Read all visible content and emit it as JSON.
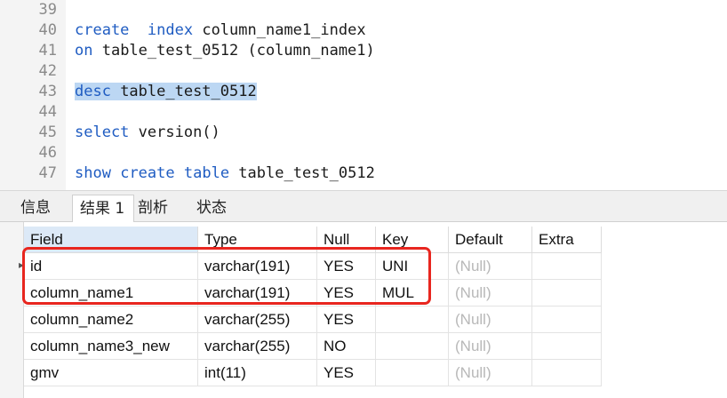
{
  "editor": {
    "lines": [
      {
        "num": "39",
        "parts": []
      },
      {
        "num": "40",
        "parts": [
          {
            "t": "create",
            "kw": true
          },
          {
            "t": "  ",
            "kw": false
          },
          {
            "t": "index",
            "kw": true
          },
          {
            "t": " column_name1_index",
            "kw": false
          }
        ]
      },
      {
        "num": "41",
        "parts": [
          {
            "t": "on",
            "kw": true
          },
          {
            "t": " table_test_0512 (column_name1)",
            "kw": false
          }
        ]
      },
      {
        "num": "42",
        "parts": []
      },
      {
        "num": "43",
        "parts": [
          {
            "t": "desc",
            "kw": true,
            "sel": true
          },
          {
            "t": " table_test_0512",
            "kw": false,
            "sel": true
          }
        ]
      },
      {
        "num": "44",
        "parts": []
      },
      {
        "num": "45",
        "parts": [
          {
            "t": "select",
            "kw": true
          },
          {
            "t": " version()",
            "kw": false
          }
        ]
      },
      {
        "num": "46",
        "parts": []
      },
      {
        "num": "47",
        "parts": [
          {
            "t": "show",
            "kw": true
          },
          {
            "t": " ",
            "kw": false
          },
          {
            "t": "create",
            "kw": true
          },
          {
            "t": " ",
            "kw": false
          },
          {
            "t": "table",
            "kw": true
          },
          {
            "t": " table_test_0512",
            "kw": false
          }
        ]
      }
    ]
  },
  "tabs": [
    {
      "label": "信息",
      "active": false
    },
    {
      "label": "结果 1",
      "active": true
    },
    {
      "label": "剖析",
      "active": false
    },
    {
      "label": "状态",
      "active": false
    }
  ],
  "grid": {
    "columns": [
      "Field",
      "Type",
      "Null",
      "Key",
      "Default",
      "Extra"
    ],
    "rows": [
      [
        "id",
        "varchar(191)",
        "YES",
        "UNI",
        "(Null)",
        ""
      ],
      [
        "column_name1",
        "varchar(191)",
        "YES",
        "MUL",
        "(Null)",
        ""
      ],
      [
        "column_name2",
        "varchar(255)",
        "YES",
        "",
        "(Null)",
        ""
      ],
      [
        "column_name3_new",
        "varchar(255)",
        "NO",
        "",
        "(Null)",
        ""
      ],
      [
        "gmv",
        "int(11)",
        "YES",
        "",
        "(Null)",
        ""
      ]
    ]
  },
  "colors": {
    "keyword": "#1f5cc2",
    "selection": "#bcd7f3",
    "highlight_box": "#e8261f",
    "null_text": "#b8b8b8"
  }
}
